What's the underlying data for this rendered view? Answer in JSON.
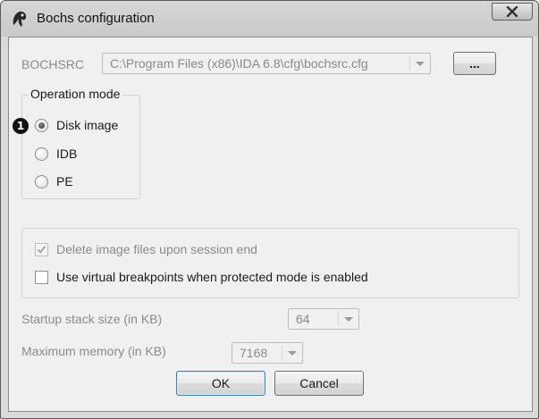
{
  "window": {
    "title": "Bochs configuration",
    "close_symbol": "✕"
  },
  "bochsrc": {
    "label": "BOCHSRC",
    "path": "C:\\Program Files (x86)\\IDA 6.8\\cfg\\bochsrc.cfg",
    "browse_label": "..."
  },
  "operation_mode": {
    "legend": "Operation mode",
    "options": [
      {
        "label": "Disk image",
        "checked": true
      },
      {
        "label": "IDB",
        "checked": false
      },
      {
        "label": "PE",
        "checked": false
      }
    ],
    "annotation": "1"
  },
  "options": {
    "delete_image_files": {
      "label": "Delete image files upon session end",
      "checked": true,
      "enabled": false
    },
    "virtual_breakpoints": {
      "label": "Use virtual breakpoints when protected mode is enabled",
      "checked": false,
      "enabled": true
    }
  },
  "startup_stack": {
    "label": "Startup stack size (in KB)",
    "value": "64"
  },
  "max_memory": {
    "label": "Maximum memory (in KB)",
    "value": "7168"
  },
  "buttons": {
    "ok": "OK",
    "cancel": "Cancel"
  },
  "icons": {
    "app": "bochs-head-icon",
    "close": "close-icon",
    "dropdown": "chevron-down-icon",
    "checkmark": "checkmark-icon"
  }
}
